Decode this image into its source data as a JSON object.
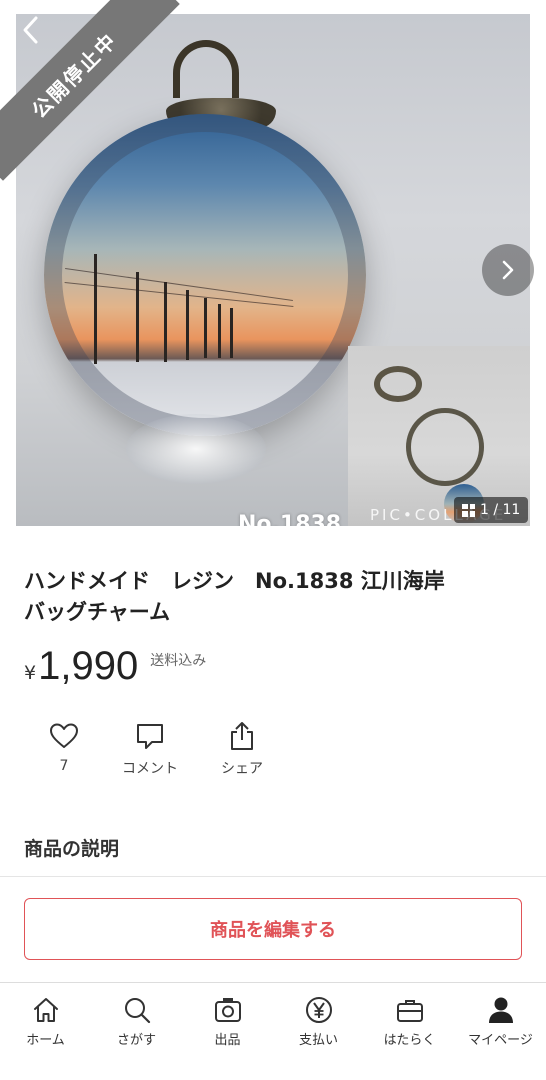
{
  "gallery": {
    "status_label": "公開停止中",
    "photo_caption": "No.1838",
    "collage_watermark": "PIC•COLLAGE",
    "counter": "1 / 11"
  },
  "product": {
    "title_line1": "ハンドメイド　レジン　No.1838 江川海岸",
    "title_line2": "バッグチャーム",
    "currency": "¥",
    "price": "1,990",
    "shipping": "送料込み"
  },
  "actions": {
    "like_count": "7",
    "comment_label": "コメント",
    "share_label": "シェア"
  },
  "description": {
    "section_title": "商品の説明"
  },
  "edit_button": {
    "label": "商品を編集する"
  },
  "nav": {
    "items": [
      {
        "label": "ホーム",
        "icon": "home-icon"
      },
      {
        "label": "さがす",
        "icon": "search-icon"
      },
      {
        "label": "出品",
        "icon": "camera-icon"
      },
      {
        "label": "支払い",
        "icon": "yen-icon"
      },
      {
        "label": "はたらく",
        "icon": "briefcase-icon"
      },
      {
        "label": "マイページ",
        "icon": "person-icon"
      }
    ]
  },
  "colors": {
    "accent_red": "#e05357",
    "status_gray": "#777777"
  }
}
